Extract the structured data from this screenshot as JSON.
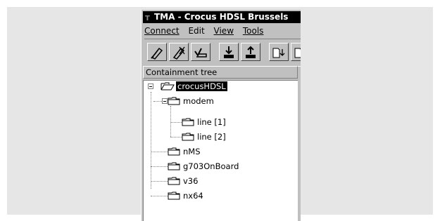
{
  "window": {
    "title": "TMA - Crocus HDSL Brussels"
  },
  "menu": [
    "Connect",
    "Edit",
    "View",
    "Tools"
  ],
  "toolbar": {
    "buttons": [
      "connect-icon",
      "disconnect-icon",
      "check-icon",
      "download-icon",
      "upload-icon",
      "new-document-icon",
      "document-icon"
    ]
  },
  "panel": {
    "header": "Containment tree"
  },
  "tree": {
    "root": "crocusHDSL",
    "modem": "modem",
    "line1": "line [1]",
    "line2": "line [2]",
    "nms": "nMS",
    "g703": "g703OnBoard",
    "v36": "v36",
    "nx64": "nx64"
  },
  "colors": {
    "selection": "#000000",
    "window": "#c0c0c0",
    "backdrop": "#e6e6e6"
  }
}
